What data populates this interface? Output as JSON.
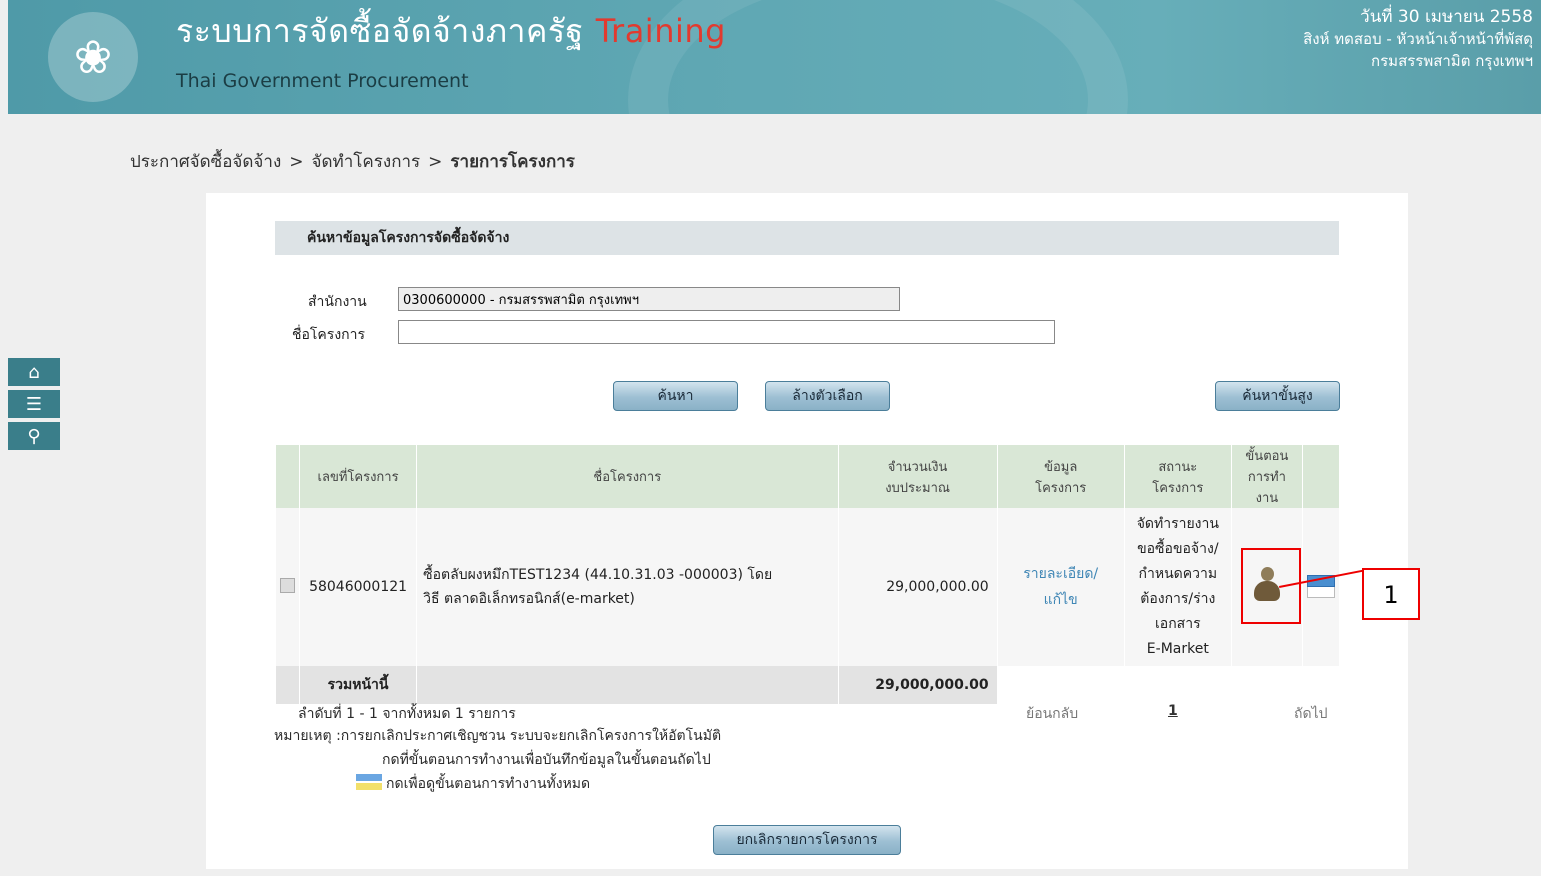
{
  "header": {
    "title_th": "ระบบการจัดซื้อจัดจ้างภาครัฐ",
    "title_training": "Training",
    "title_en": "Thai Government Procurement",
    "date": "วันที่ 30 เมษายน 2558",
    "user": "สิงห์ ทดสอบ - หัวหน้าเจ้าหน้าที่พัสดุ",
    "department": "กรมสรรพสามิต กรุงเทพฯ"
  },
  "breadcrumb": {
    "item1": "ประกาศจัดซื้อจัดจ้าง",
    "item2": "จัดทำโครงการ",
    "current": "รายการโครงการ",
    "separator": ">"
  },
  "search": {
    "section_title": "ค้นหาข้อมูลโครงการจัดซื้อจัดจ้าง",
    "office_label": "สำนักงาน",
    "office_value": "0300600000 - กรมสรรพสามิต กรุงเทพฯ",
    "project_name_label": "ชื่อโครงการ",
    "project_name_value": "",
    "search_button": "ค้นหา",
    "clear_button": "ล้างตัวเลือก",
    "advanced_button": "ค้นหาขั้นสูง"
  },
  "table": {
    "headers": {
      "project_no": "เลขที่โครงการ",
      "project_name": "ชื่อโครงการ",
      "budget_line1": "จำนวนเงิน",
      "budget_line2": "งบประมาณ",
      "info_line1": "ข้อมูล",
      "info_line2": "โครงการ",
      "status_line1": "สถานะ",
      "status_line2": "โครงการ",
      "steps_line1": "ขั้นตอน",
      "steps_line2": "การทำ",
      "steps_line3": "งาน"
    },
    "row": {
      "project_no": "58046000121",
      "name_line1": "ซื้อตลับผงหมึกTEST1234 (44.10.31.03 -000003) โดย",
      "name_line2": "วิธี ตลาดอิเล็กทรอนิกส์(e-market)",
      "budget": "29,000,000.00",
      "detail_link_1": "รายละเอียด/",
      "detail_link_2": "แก้ไข",
      "status_1": "จัดทำรายงาน",
      "status_2": "ขอซื้อขอจ้าง/",
      "status_3": "กำหนดความ",
      "status_4": "ต้องการ/ร่าง",
      "status_5": "เอกสาร",
      "status_6": "E-Market"
    },
    "total_label": "รวมหน้านี้",
    "total_value": "29,000,000.00"
  },
  "pagination": {
    "summary": "ลำดับที่ 1 - 1 จากทั้งหมด 1 รายการ",
    "back": "ย้อนกลับ",
    "page": "1",
    "next": "ถัดไป"
  },
  "notes": {
    "line1": "หมายเหตุ :การยกเลิกประกาศเชิญชวน ระบบจะยกเลิกโครงการให้อัตโนมัติ",
    "line2": "กดที่ขั้นตอนการทำงานเพื่อบันทึกข้อมูลในขั้นตอนถัดไป",
    "line3": "กดเพื่อดูขั้นตอนการทำงานทั้งหมด"
  },
  "cancel_button": "ยกเลิกรายการโครงการ",
  "annotation": {
    "number": "1"
  },
  "colors": {
    "header": "#5fa7b3",
    "accent_red": "#e23a2f",
    "table_header": "#d9e7d6",
    "link": "#3f86b5"
  }
}
